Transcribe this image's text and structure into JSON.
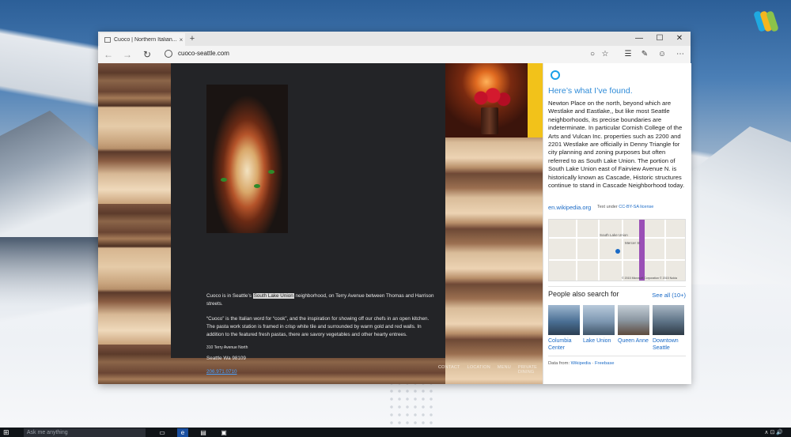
{
  "browser": {
    "tab_title": "Cuoco | Northern Italian...",
    "tab_close": "×",
    "new_tab": "+",
    "window_controls": {
      "minimize": "—",
      "maximize": "☐",
      "close": "✕"
    },
    "url": "cuoco-seattle.com",
    "nav": {
      "back": "←",
      "forward": "→",
      "refresh": "↻"
    },
    "toolbar_icons": [
      "circle-icon",
      "favorite-star-icon",
      "reading-list-icon",
      "web-note-icon",
      "feedback-smiley-icon",
      "more-icon"
    ],
    "toolbar_glyphs": {
      "cortana": "○",
      "favorite": "☆",
      "reading": "☰",
      "note": "✎",
      "feedback": "☺",
      "more": "⋯"
    }
  },
  "site": {
    "para1_before": "Cuoco is in Seattle’s ",
    "para1_highlight": "South Lake Union",
    "para1_after": " neighborhood, on Terry Avenue between Thomas and Harrison streets.",
    "para2": "“Cuoco” is the Italian word for “cook”, and the inspiration for showing off our chefs in an open kitchen.  The pasta work station is framed in crisp white tile and surrounded by warm gold and red walls.  In addition to the featured fresh pastas, there are savory vegetables and other hearty entrees.",
    "address_line": "310 Terry Avenue North",
    "city_line": "Seattle Wa 98109",
    "phone": "206.971.0710",
    "footer_links": [
      "CONTACT",
      "LOCATION",
      "MENU",
      "PRIVATE DINING"
    ]
  },
  "cortana": {
    "heading": "Here’s what I’ve found.",
    "body": "Newton Place on the north, beyond which are Westlake and Eastlake,, but like most Seattle neighborhoods, its precise boundaries are indeterminate. In particular Cornish College of the Arts and Vulcan Inc. properties such as 2200 and 2201 Westlake are officially in Denny Triangle for city planning and zoning purposes but often referred to as South Lake Union. The portion of South Lake Union east of Fairview Avenue N. is historically known as Cascade, Historic structures continue to stand in Cascade Neighborhood today.",
    "source": "en.wikipedia.org",
    "license_prefix": "Text under ",
    "license_link": "CC-BY-SA license",
    "map_labels": {
      "south_lake_union": "South Lake Union",
      "mercer": "Mercer St",
      "copyright": "© 2015 Microsoft Corporation © 2015 Nokia"
    },
    "people_also_search": "People also search for",
    "see_all": "See all (10+)",
    "related": [
      {
        "label": "Columbia Center",
        "color": "#4a6f94"
      },
      {
        "label": "Lake Union",
        "color": "#7d97b1"
      },
      {
        "label": "Queen Anne",
        "color": "#8b97a2"
      },
      {
        "label": "Downtown Seattle",
        "color": "#5d7286"
      }
    ],
    "data_from_prefix": "Data from: ",
    "data_from_wikipedia": "Wikipedia",
    "data_from_sep": " · ",
    "data_from_freebase": "Freebase"
  },
  "taskbar": {
    "start": "⊞",
    "search_placeholder": "Ask me anything",
    "tray": "∧  ⊡  🔊"
  },
  "colors": {
    "accent": "#2e8bd8",
    "card": "#232427",
    "link": "#1a6ac6"
  }
}
